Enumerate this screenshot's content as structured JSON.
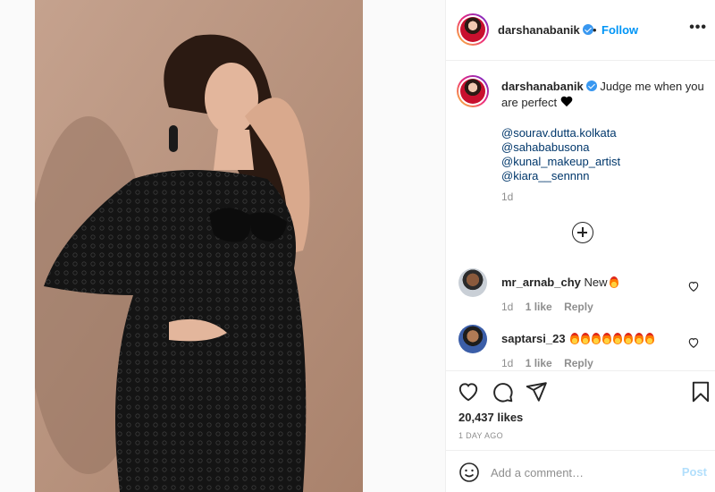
{
  "post": {
    "image_description": "Woman in black lace dress posing against beige background"
  },
  "header": {
    "username": "darshanabanik",
    "separator": "•",
    "follow_label": "Follow",
    "more_label": "•••"
  },
  "caption": {
    "username": "darshanabanik",
    "text_line": "Judge me when you are perfect",
    "mentions": [
      "@sourav.dutta.kolkata",
      "@sahababusona",
      "@kunal_makeup_artist",
      "@kiara__sennnn"
    ],
    "age": "1d"
  },
  "comments": [
    {
      "username": "mr_arnab_chy",
      "text": "New",
      "flames": 1,
      "age": "1d",
      "likes": "1 like",
      "reply": "Reply"
    },
    {
      "username": "saptarsi_23",
      "text": "",
      "flames": 8,
      "age": "1d",
      "likes": "1 like",
      "reply": "Reply"
    }
  ],
  "actions": {
    "likes_count": "20,437 likes",
    "date": "1 DAY AGO"
  },
  "add_comment": {
    "placeholder": "Add a comment…",
    "post_label": "Post"
  },
  "colors": {
    "accent": "#0095f6",
    "post_disabled": "#b2dffc",
    "muted": "#8e8e8e"
  }
}
